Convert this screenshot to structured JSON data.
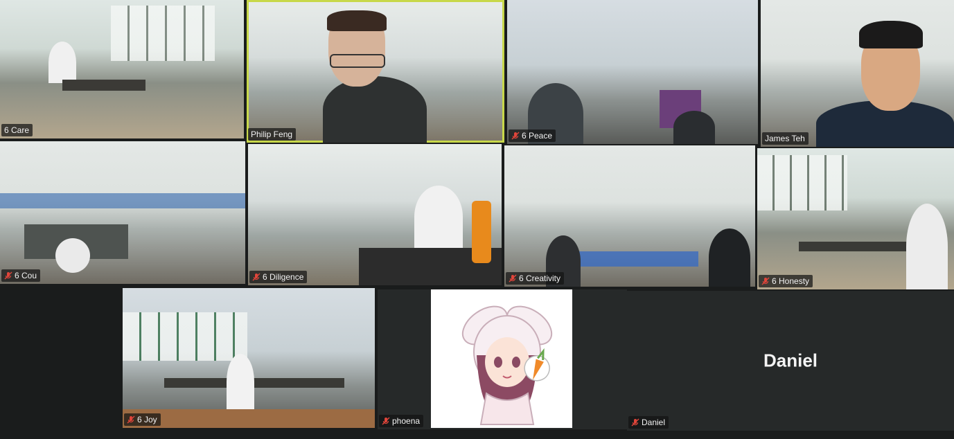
{
  "tiles": [
    {
      "name": "6 Care",
      "muted": false
    },
    {
      "name": "Philip Feng",
      "muted": false,
      "active": true
    },
    {
      "name": "6 Peace",
      "muted": true
    },
    {
      "name": "James Teh",
      "muted": false
    },
    {
      "name": "6 Cou",
      "muted": true
    },
    {
      "name": "6 Diligence",
      "muted": true
    },
    {
      "name": "6 Creativity",
      "muted": true
    },
    {
      "name": "6 Honesty",
      "muted": true
    },
    {
      "name": "6 Joy",
      "muted": true
    },
    {
      "name": "phoena",
      "muted": true
    },
    {
      "name": "Daniel",
      "muted": true,
      "display_name": "Daniel"
    }
  ],
  "colors": {
    "active_speaker_border": "#c8d84a",
    "muted_icon": "#e0453a",
    "background": "#1a1c1c"
  }
}
